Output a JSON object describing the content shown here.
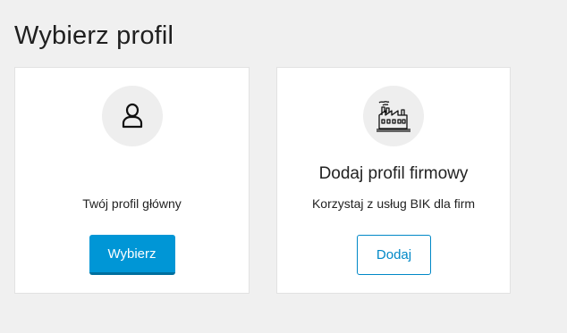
{
  "page": {
    "title": "Wybierz profil"
  },
  "colors": {
    "background": "#f0f0f0",
    "card": "#ffffff",
    "primary": "#0096d6",
    "icon_circle": "#eeeeee"
  },
  "cards": [
    {
      "icon": "user-icon",
      "heading": "",
      "description": "Twój profil główny",
      "button_label": "Wybierz",
      "button_style": "filled"
    },
    {
      "icon": "factory-icon",
      "heading": "Dodaj profil firmowy",
      "description": "Korzystaj z usług BIK dla firm",
      "button_label": "Dodaj",
      "button_style": "outline"
    }
  ]
}
